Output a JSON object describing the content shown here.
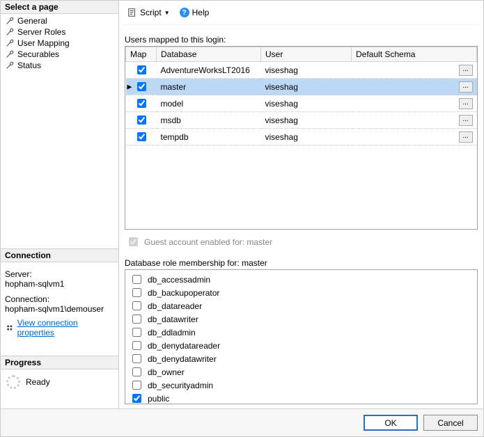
{
  "left": {
    "select_page_header": "Select a page",
    "nav": [
      {
        "label": "General"
      },
      {
        "label": "Server Roles"
      },
      {
        "label": "User Mapping"
      },
      {
        "label": "Securables"
      },
      {
        "label": "Status"
      }
    ],
    "connection_header": "Connection",
    "server_label": "Server:",
    "server_value": "hopham-sqlvm1",
    "connection_label": "Connection:",
    "connection_value": "hopham-sqlvm1\\demouser",
    "view_conn_props": "View connection properties",
    "progress_header": "Progress",
    "progress_status": "Ready"
  },
  "toolbar": {
    "script": "Script",
    "help": "Help"
  },
  "mapping": {
    "label": "Users mapped to this login:",
    "columns": {
      "map": "Map",
      "database": "Database",
      "user": "User",
      "schema": "Default Schema"
    },
    "rows": [
      {
        "checked": true,
        "database": "AdventureWorksLT2016",
        "user": "viseshag",
        "schema": "",
        "selected": false
      },
      {
        "checked": true,
        "database": "master",
        "user": "viseshag",
        "schema": "",
        "selected": true
      },
      {
        "checked": true,
        "database": "model",
        "user": "viseshag",
        "schema": "",
        "selected": false
      },
      {
        "checked": true,
        "database": "msdb",
        "user": "viseshag",
        "schema": "",
        "selected": false
      },
      {
        "checked": true,
        "database": "tempdb",
        "user": "viseshag",
        "schema": "",
        "selected": false
      }
    ],
    "guest_label": "Guest account enabled for: master"
  },
  "roles": {
    "label": "Database role membership for: master",
    "items": [
      {
        "name": "db_accessadmin",
        "checked": false
      },
      {
        "name": "db_backupoperator",
        "checked": false
      },
      {
        "name": "db_datareader",
        "checked": false
      },
      {
        "name": "db_datawriter",
        "checked": false
      },
      {
        "name": "db_ddladmin",
        "checked": false
      },
      {
        "name": "db_denydatareader",
        "checked": false
      },
      {
        "name": "db_denydatawriter",
        "checked": false
      },
      {
        "name": "db_owner",
        "checked": false
      },
      {
        "name": "db_securityadmin",
        "checked": false
      },
      {
        "name": "public",
        "checked": true
      }
    ]
  },
  "footer": {
    "ok": "OK",
    "cancel": "Cancel"
  }
}
